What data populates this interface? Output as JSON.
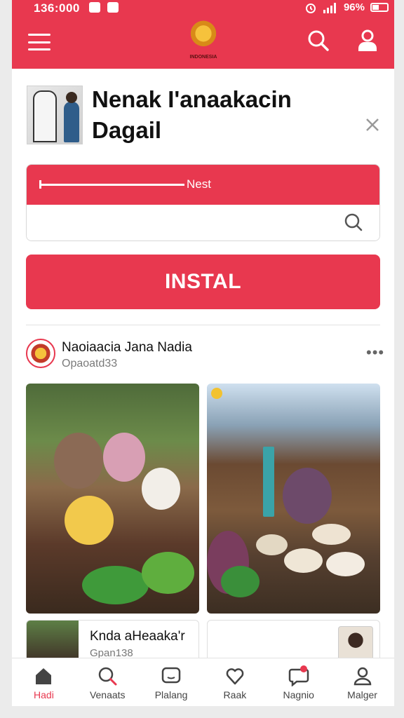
{
  "status_bar": {
    "time": "136:000",
    "battery": "96%"
  },
  "app": {
    "logo_text": "INDONESIA"
  },
  "header": {
    "title_line1": "Nenak I'anaakacin",
    "title_line2": "Dagail"
  },
  "search": {
    "band_label": "Nest",
    "placeholder": ""
  },
  "install": {
    "label": "INSTAL"
  },
  "post": {
    "author": "Naoiaacia Jana Nadia",
    "subtitle": "Opaoatd33",
    "more": "•••"
  },
  "cards": {
    "a_title": "Knda aHeaaka'r",
    "a_subtitle": "Gpan138"
  },
  "bottom_nav": {
    "items": [
      {
        "label": "Hadi",
        "icon": "home-icon",
        "active": true
      },
      {
        "label": "Venaats",
        "icon": "search-icon",
        "active": false
      },
      {
        "label": "Plalang",
        "icon": "message-square-icon",
        "active": false
      },
      {
        "label": "Raak",
        "icon": "heart-icon",
        "active": false
      },
      {
        "label": "Nagnio",
        "icon": "chat-bubble-icon",
        "active": false
      },
      {
        "label": "Malger",
        "icon": "user-icon",
        "active": false
      }
    ]
  },
  "colors": {
    "accent": "#e8384f",
    "background": "#ffffff",
    "page": "#ebebeb"
  }
}
